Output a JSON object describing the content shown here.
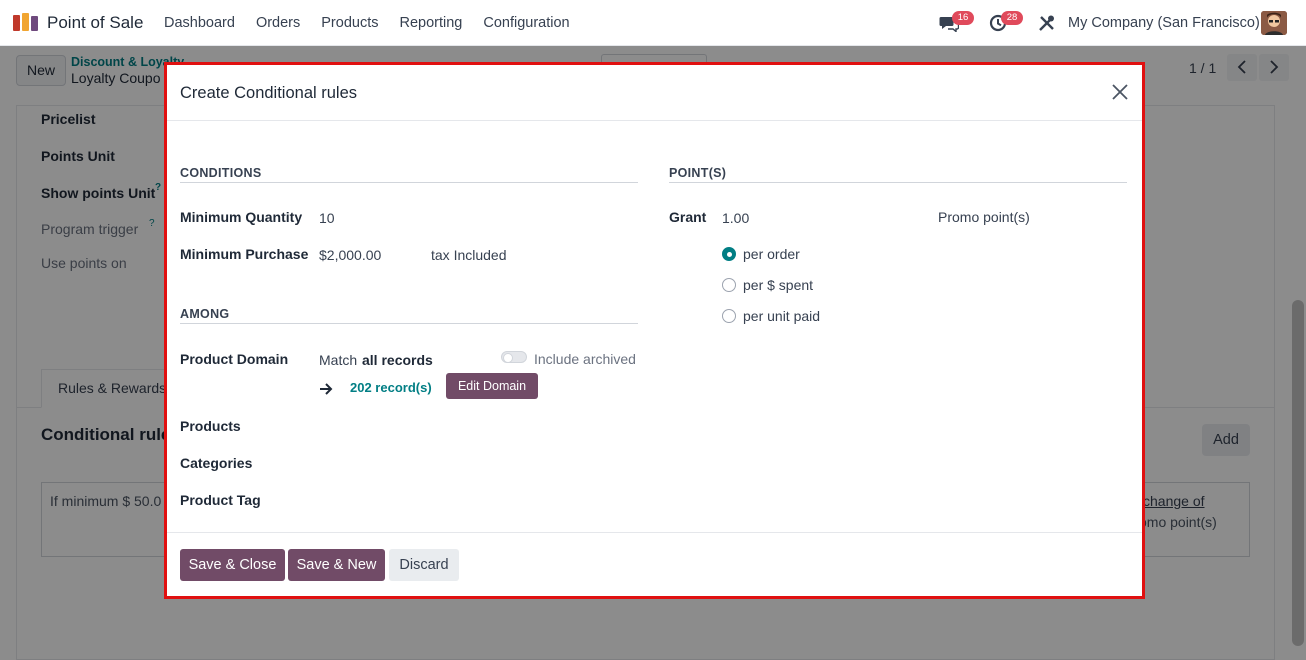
{
  "navbar": {
    "app_name": "Point of Sale",
    "menu": [
      "Dashboard",
      "Orders",
      "Products",
      "Reporting",
      "Configuration"
    ],
    "messages_badge": "16",
    "activities_badge": "28",
    "company": "My Company (San Francisco)"
  },
  "control_panel": {
    "new_label": "New",
    "breadcrumb_parent": "Discount & Loyalty",
    "breadcrumb_current": "Loyalty Coupo",
    "pager": "1 / 1"
  },
  "background_form": {
    "labels": [
      "Pricelist",
      "Points Unit",
      "Show points Unit",
      "Program trigger",
      "Use points on"
    ],
    "help_mark": "?",
    "tab_rules": "Rules & Rewards",
    "conditional_title": "Conditional rule",
    "add_label": "Add",
    "rule_summary": "If minimum $ 50.0",
    "rule_change": "change of",
    "rule_promo": "omo point(s)"
  },
  "modal": {
    "title": "Create Conditional rules",
    "conditions": {
      "title": "CONDITIONS",
      "min_qty_label": "Minimum Quantity",
      "min_qty_value": "10",
      "min_purchase_label": "Minimum Purchase",
      "min_purchase_value": "$2,000.00",
      "tax_label": "tax Included"
    },
    "among": {
      "title": "AMONG",
      "product_domain_label": "Product Domain",
      "match_prefix": "Match",
      "match_value": "all records",
      "include_archived": "Include archived",
      "records_link": "202 record(s)",
      "edit_domain": "Edit Domain",
      "products_label": "Products",
      "categories_label": "Categories",
      "product_tag_label": "Product Tag"
    },
    "points": {
      "title": "POINT(S)",
      "grant_label": "Grant",
      "grant_value": "1.00",
      "unit": "Promo point(s)",
      "options": [
        "per order",
        "per $ spent",
        "per unit paid"
      ],
      "selected": "per order"
    },
    "footer": {
      "save_close": "Save & Close",
      "save_new": "Save & New",
      "discard": "Discard"
    }
  },
  "colors": {
    "primary": "#714b67",
    "teal": "#017e84",
    "highlight_border": "#e01010",
    "badge": "#e04a5b"
  }
}
